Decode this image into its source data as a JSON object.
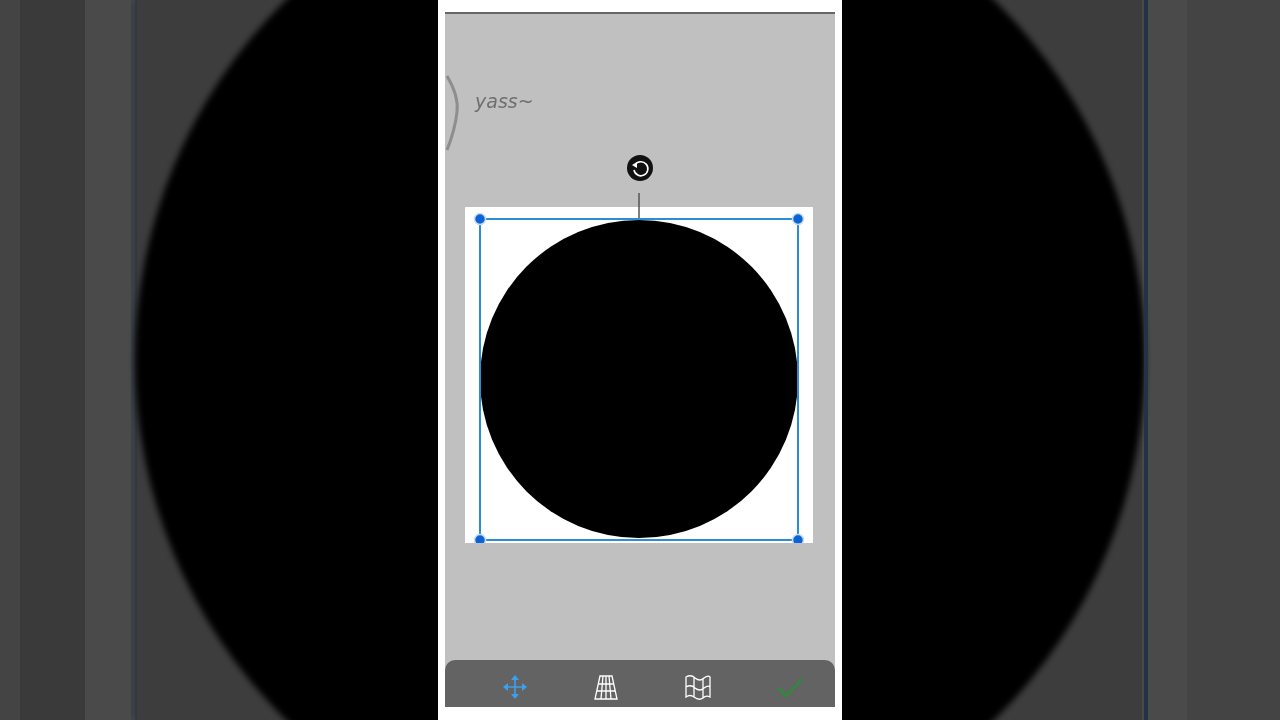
{
  "canvas": {
    "handwriting": "yass~"
  },
  "toolbar": [
    {
      "kind": "move",
      "selected": true
    },
    {
      "kind": "perspective",
      "selected": false
    },
    {
      "kind": "warp",
      "selected": false
    },
    {
      "kind": "confirm",
      "selected": false
    }
  ]
}
